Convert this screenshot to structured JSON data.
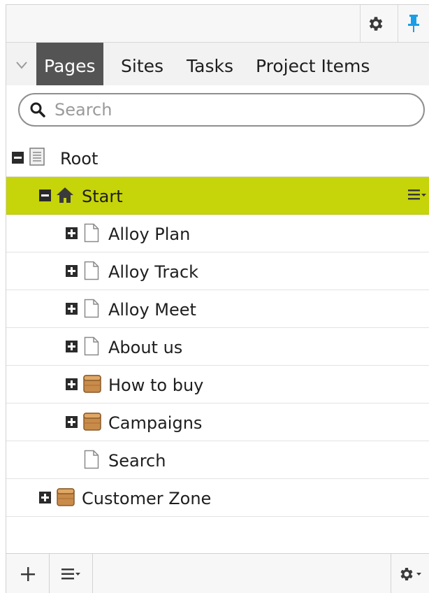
{
  "toolbar": {
    "settings_icon": "gear-icon",
    "pin_icon": "pin-icon",
    "pin_color": "#1a9ee6"
  },
  "tabs": [
    {
      "label": "Pages",
      "active": true
    },
    {
      "label": "Sites",
      "active": false
    },
    {
      "label": "Tasks",
      "active": false
    },
    {
      "label": "Project Items",
      "active": false
    }
  ],
  "search": {
    "placeholder": "Search",
    "value": ""
  },
  "tree": {
    "selected_color": "#c6d40a",
    "items": [
      {
        "label": "Root",
        "depth": 0,
        "toggle": "minus",
        "icon": "root-page-icon"
      },
      {
        "label": "Start",
        "depth": 1,
        "toggle": "minus",
        "icon": "home-icon",
        "selected": true
      },
      {
        "label": "Alloy Plan",
        "depth": 2,
        "toggle": "plus",
        "icon": "page-icon"
      },
      {
        "label": "Alloy Track",
        "depth": 2,
        "toggle": "plus",
        "icon": "page-icon"
      },
      {
        "label": "Alloy Meet",
        "depth": 2,
        "toggle": "plus",
        "icon": "page-icon"
      },
      {
        "label": "About us",
        "depth": 2,
        "toggle": "plus",
        "icon": "page-icon"
      },
      {
        "label": "How to buy",
        "depth": 2,
        "toggle": "plus",
        "icon": "container-icon"
      },
      {
        "label": "Campaigns",
        "depth": 2,
        "toggle": "plus",
        "icon": "container-icon"
      },
      {
        "label": "Search",
        "depth": 2,
        "toggle": "none",
        "icon": "page-icon"
      },
      {
        "label": "Customer Zone",
        "depth": 1,
        "toggle": "plus",
        "icon": "container-icon"
      }
    ]
  },
  "bottombar": {
    "add_icon": "plus-icon",
    "menu_icon": "menu-icon",
    "options_icon": "gear-dropdown-icon"
  }
}
